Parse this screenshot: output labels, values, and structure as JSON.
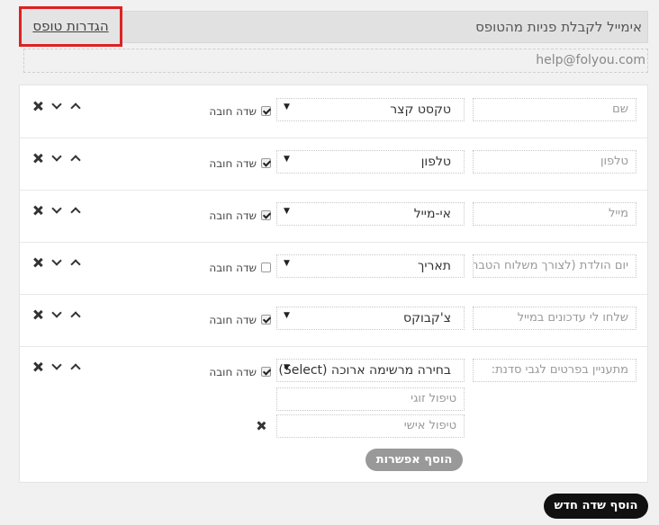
{
  "header": {
    "title": "אימייל לקבלת פניות מהטופס",
    "settings_link": "הגדרות טופס",
    "email": "help@folyou.com"
  },
  "required_label": "שדה חובה",
  "fields": [
    {
      "name": "שם",
      "type": "טקסט קצר",
      "required": true
    },
    {
      "name": "טלפון",
      "type": "טלפון",
      "required": true
    },
    {
      "name": "מייל",
      "type": "אי-מייל",
      "required": true
    },
    {
      "name": "יום הולדת (לצורך משלוח הטבה)",
      "type": "תאריך",
      "required": false
    },
    {
      "name": "שלחו לי עדכונים במייל",
      "type": "צ'קבוקס",
      "required": true
    },
    {
      "name": "מתעניין בפרטים לגבי סדנת:",
      "type": "בחירה מרשימה ארוכה (Select)",
      "required": true
    }
  ],
  "options": [
    "טיפול זוגי",
    "טיפול אישי"
  ],
  "add_option_label": "הוסף אפשרות",
  "add_field_label": "הוסף שדה חדש",
  "icons": {
    "remove": "close-icon",
    "move_down": "chevron-down-icon",
    "move_up": "chevron-up-icon",
    "dropdown": "dropdown-arrow-icon"
  }
}
